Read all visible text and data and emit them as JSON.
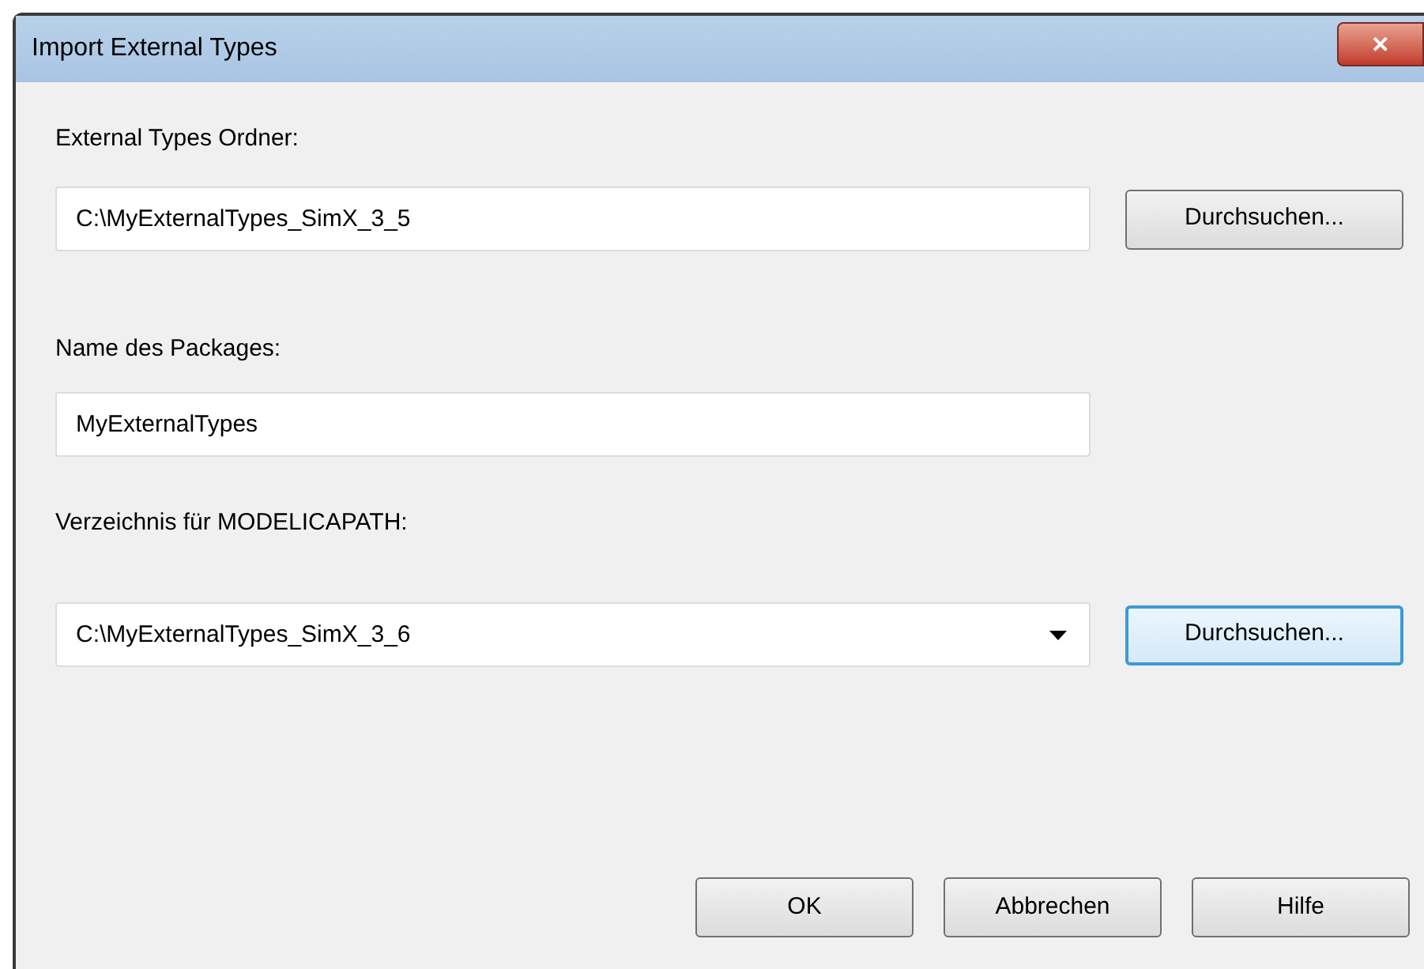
{
  "window": {
    "title": "Import External Types",
    "close_label": "✕"
  },
  "fields": [
    {
      "kind": "text",
      "label": "External Types Ordner:",
      "value": "C:\\MyExternalTypes_SimX_3_5",
      "button": {
        "label": "Durchsuchen...",
        "focused": false
      }
    },
    {
      "kind": "text",
      "label": "Name des Packages:",
      "value": "MyExternalTypes"
    },
    {
      "kind": "combo",
      "label": "Verzeichnis für MODELICAPATH:",
      "value": "C:\\MyExternalTypes_SimX_3_6",
      "button": {
        "label": "Durchsuchen...",
        "focused": true
      }
    }
  ],
  "buttons": [
    {
      "label": "OK"
    },
    {
      "label": "Abbrechen"
    },
    {
      "label": "Hilfe"
    }
  ]
}
